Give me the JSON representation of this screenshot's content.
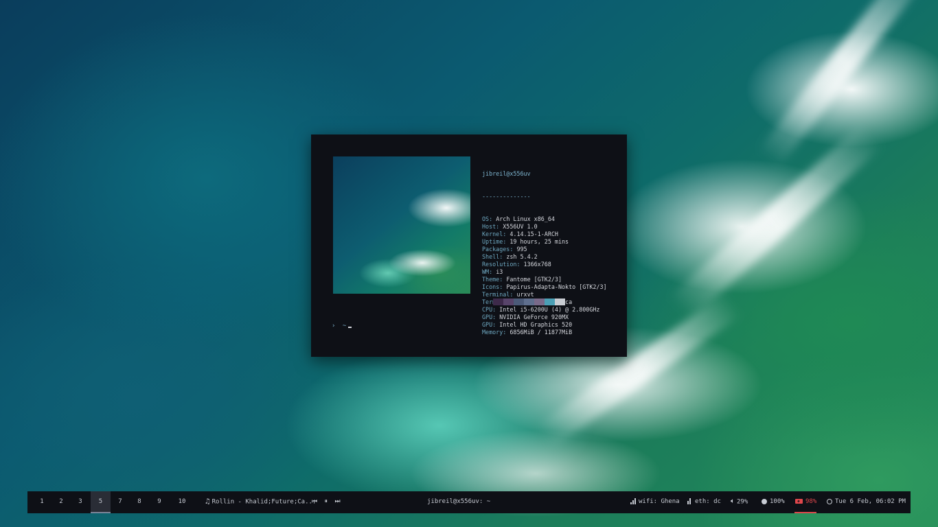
{
  "terminal": {
    "user_host": "jibreil@x556uv",
    "separator": "--------------",
    "fields": [
      {
        "key": "OS",
        "value": "Arch Linux x86_64"
      },
      {
        "key": "Host",
        "value": "X556UV 1.0"
      },
      {
        "key": "Kernel",
        "value": "4.14.15-1-ARCH"
      },
      {
        "key": "Uptime",
        "value": "19 hours, 25 mins"
      },
      {
        "key": "Packages",
        "value": "995"
      },
      {
        "key": "Shell",
        "value": "zsh 5.4.2"
      },
      {
        "key": "Resolution",
        "value": "1366x768"
      },
      {
        "key": "WM",
        "value": "i3"
      },
      {
        "key": "Theme",
        "value": "Fantome [GTK2/3]"
      },
      {
        "key": "Icons",
        "value": "Papirus-Adapta-Nokto [GTK2/3]"
      },
      {
        "key": "Terminal",
        "value": "urxvt"
      },
      {
        "key": "Terminal Font",
        "value": "scientifica"
      },
      {
        "key": "CPU",
        "value": "Intel i5-6200U (4) @ 2.800GHz"
      },
      {
        "key": "GPU",
        "value": "NVIDIA GeForce 920MX"
      },
      {
        "key": "GPU",
        "value": "Intel HD Graphics 520"
      },
      {
        "key": "Memory",
        "value": "6856MiB / 11877MiB"
      }
    ],
    "palette": [
      "#3d2a4a",
      "#58446a",
      "#4b5a78",
      "#5f6f8e",
      "#7a6a8a",
      "#4b9fb5",
      "#c9cdd3"
    ],
    "prompt_arrow": "›",
    "prompt_path": "~"
  },
  "bar": {
    "workspaces": [
      "1",
      "2",
      "3",
      "5",
      "7",
      "8",
      "9",
      "10"
    ],
    "active_workspace": "5",
    "music_icon": "music-note-icon",
    "now_playing": "Rollin - Khalid;Future;Ca...",
    "window_title": "jibreil@x556uv: ~",
    "wifi": "wifi: Ghena",
    "eth": "eth: dc",
    "volume": "29%",
    "brightness": "100%",
    "battery": "98%",
    "datetime": "Tue 6 Feb, 06:02 PM",
    "colors": {
      "background": "#0e1016",
      "battery": "#e0474c"
    }
  }
}
